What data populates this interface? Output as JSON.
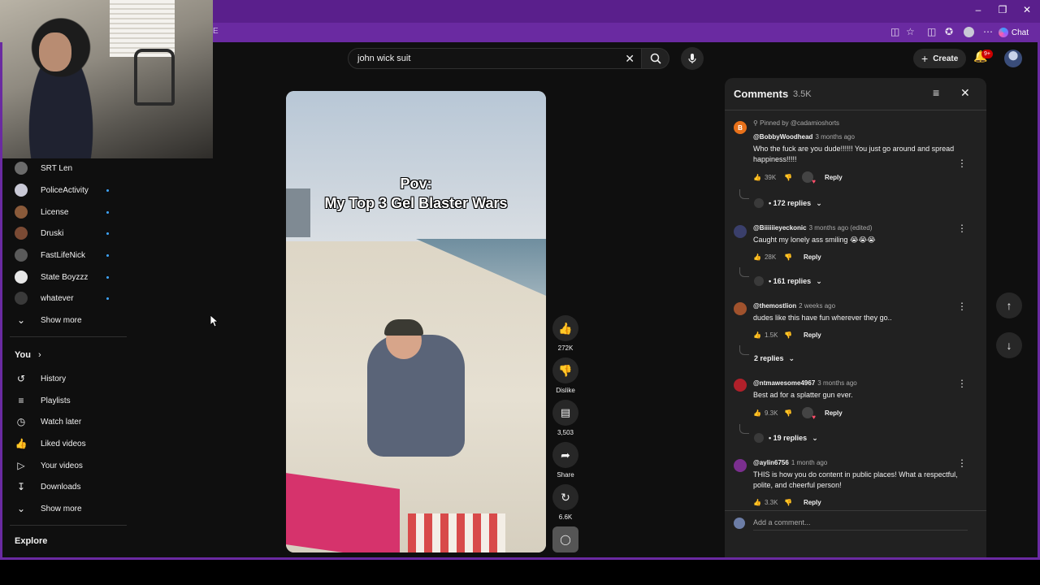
{
  "browser": {
    "url_fragment": "E",
    "chat_label": "Chat",
    "notification_badge": "9+"
  },
  "search": {
    "query": "john wick suit"
  },
  "header": {
    "create_label": "Create"
  },
  "sidebar": {
    "subscriptions": [
      {
        "name": "SRT Len",
        "color": "#6b6b6b",
        "new": false
      },
      {
        "name": "PoliceActivity",
        "color": "#c9c9d6",
        "new": true
      },
      {
        "name": "License",
        "color": "#8a5a3a",
        "new": true
      },
      {
        "name": "Druski",
        "color": "#7a4a34",
        "new": true
      },
      {
        "name": "FastLifeNick",
        "color": "#5a5a5a",
        "new": true
      },
      {
        "name": "State Boyzzz",
        "color": "#e8e8e8",
        "new": true
      },
      {
        "name": "whatever",
        "color": "#3a3a3a",
        "new": true
      }
    ],
    "show_more_1": "Show more",
    "you_title": "You",
    "you_items": [
      {
        "label": "History",
        "icon": "history-icon"
      },
      {
        "label": "Playlists",
        "icon": "playlists-icon"
      },
      {
        "label": "Watch later",
        "icon": "watch-later-icon"
      },
      {
        "label": "Liked videos",
        "icon": "liked-videos-icon"
      },
      {
        "label": "Your videos",
        "icon": "your-videos-icon"
      },
      {
        "label": "Downloads",
        "icon": "downloads-icon"
      }
    ],
    "show_more_2": "Show more",
    "explore_title": "Explore"
  },
  "video": {
    "caption_line1": "Pov:",
    "caption_line2": "My Top 3 Gel Blaster Wars"
  },
  "actions": {
    "likes": "272K",
    "dislike": "Dislike",
    "comments": "3,503",
    "share": "Share",
    "remix": "6.6K"
  },
  "comments_panel": {
    "title": "Comments",
    "count": "3.5K",
    "pinned_by": "Pinned by @cadamioshorts",
    "add_placeholder": "Add a comment...",
    "reply_label": "Reply",
    "items": [
      {
        "avatar_letter": "B",
        "avatar_color": "#e8711a",
        "handle": "@BobbyWoodhead",
        "age": "3 months ago",
        "text": "Who the fuck are you dude!!!!!!  You just go around and spread happiness!!!!!",
        "likes": "39K",
        "hearted": true,
        "replies": "172 replies"
      },
      {
        "avatar_letter": "",
        "avatar_color": "#3a3f6b",
        "handle": "@Biiiiiieyeckonic",
        "age": "3 months ago (edited)",
        "text": "Caught my lonely ass smiling 😭😭😭",
        "likes": "28K",
        "hearted": false,
        "replies": "161 replies"
      },
      {
        "avatar_letter": "",
        "avatar_color": "#a0522d",
        "handle": "@themostlion",
        "age": "2 weeks ago",
        "text": "dudes like this have fun wherever they go..",
        "likes": "1.5K",
        "hearted": false,
        "replies": "2 replies"
      },
      {
        "avatar_letter": "",
        "avatar_color": "#b0202a",
        "handle": "@ntmawesome4967",
        "age": "3 months ago",
        "text": "Best ad for a splatter gun ever.",
        "likes": "9.3K",
        "hearted": true,
        "replies": "19 replies"
      },
      {
        "avatar_letter": "",
        "avatar_color": "#7b2f8f",
        "handle": "@aylin6756",
        "age": "1 month ago",
        "text": "THIS is how you do content in public places! What a respectful, polite, and cheerful person!",
        "likes": "3.3K",
        "hearted": false,
        "replies": ""
      }
    ]
  },
  "colors": {
    "browser_frame": "#6a2aa1",
    "background": "#0f0f0f",
    "panel": "#212121",
    "badge": "#cc0000"
  }
}
